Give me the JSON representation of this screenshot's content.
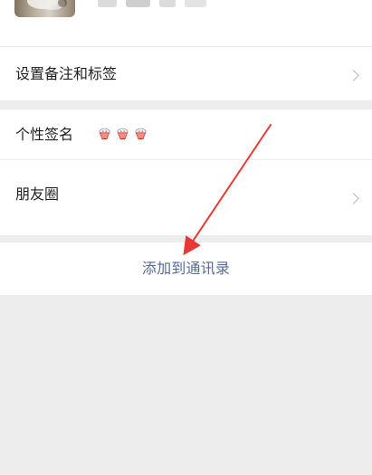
{
  "profile": {
    "avatar_name": "avatar",
    "name_obscured": true
  },
  "rows": {
    "remark_label": "设置备注和标签",
    "signature_label": "个性签名",
    "moments_label": "朋友圈"
  },
  "signature": {
    "icons": [
      "bowl-emoji-icon",
      "bowl-emoji-icon",
      "bowl-emoji-icon"
    ]
  },
  "action": {
    "add_contact_label": "添加到通讯录"
  },
  "colors": {
    "link_blue": "#576b95",
    "annotation_red": "#e53935",
    "background": "#ededed",
    "card": "#ffffff"
  }
}
